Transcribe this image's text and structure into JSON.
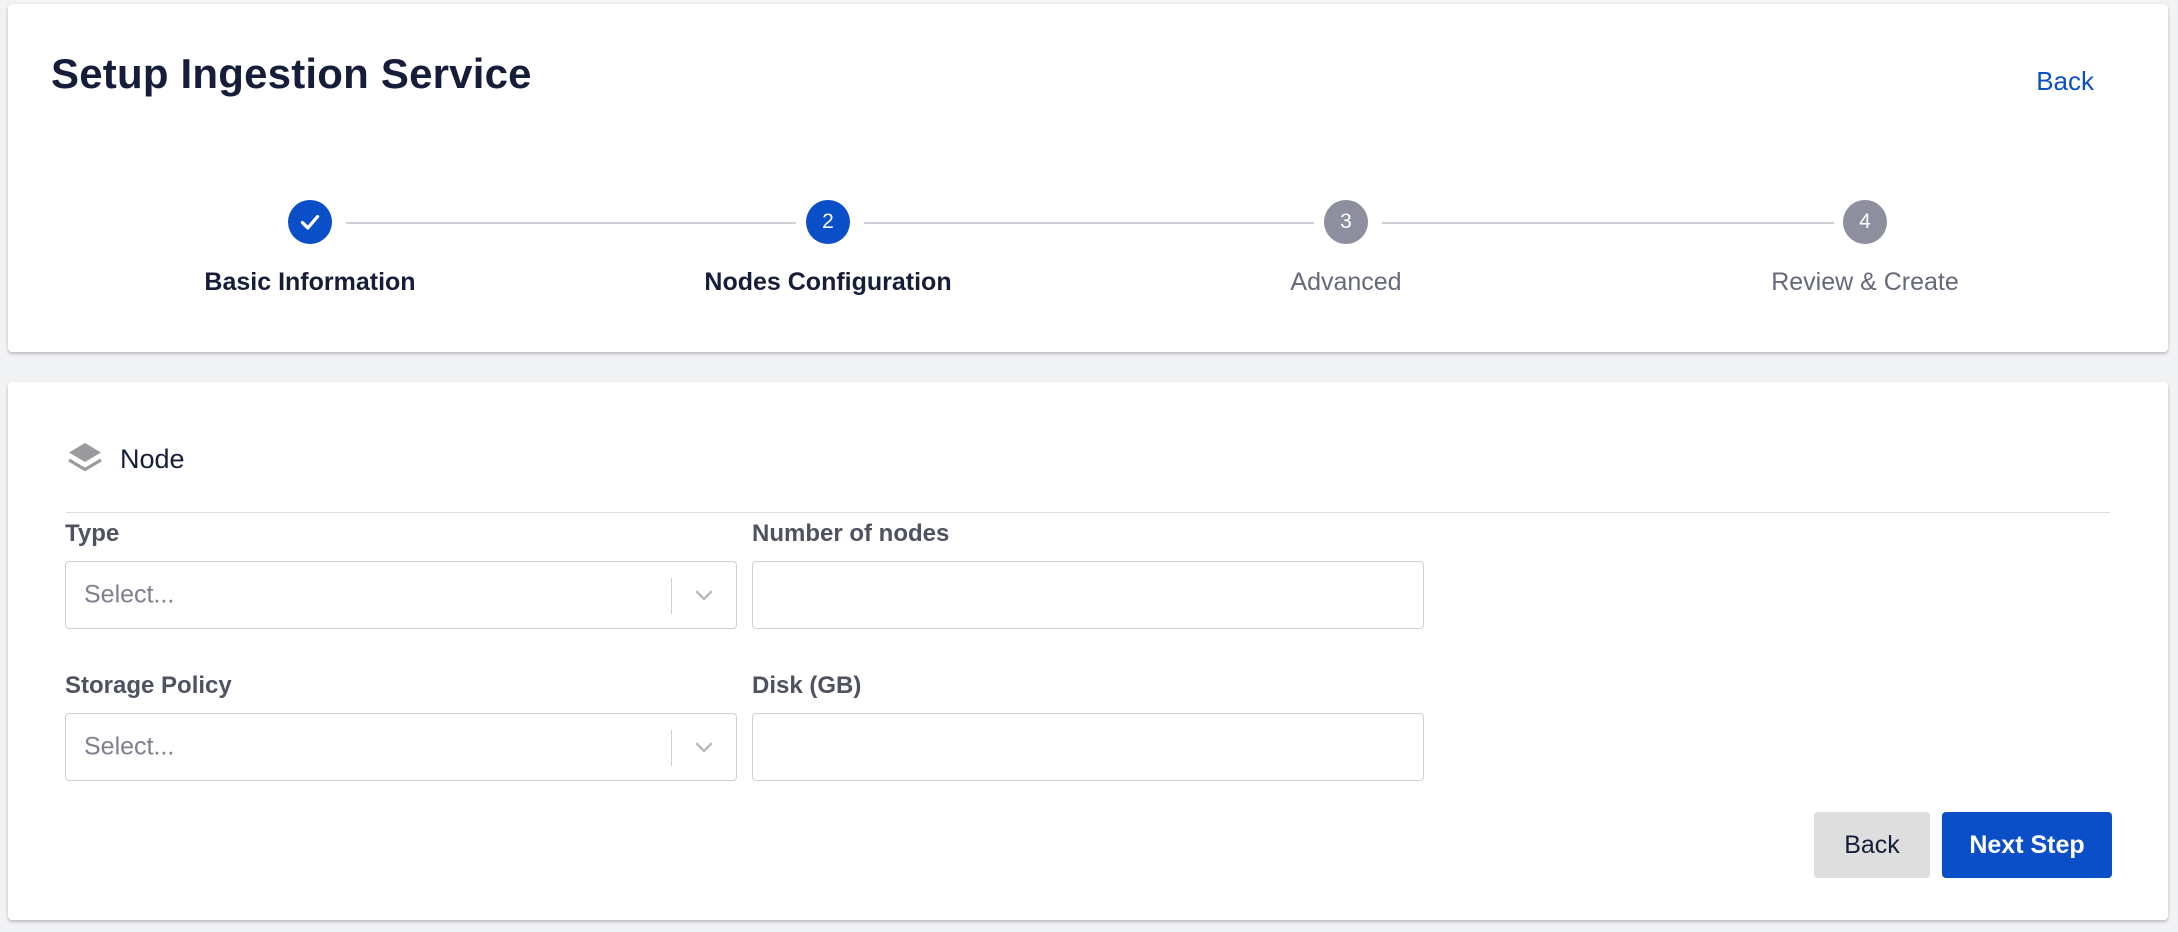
{
  "header": {
    "title": "Setup Ingestion Service",
    "back_label": "Back"
  },
  "stepper": {
    "steps": [
      {
        "number": "1",
        "label": "Basic Information",
        "state": "completed"
      },
      {
        "number": "2",
        "label": "Nodes Configuration",
        "state": "active"
      },
      {
        "number": "3",
        "label": "Advanced",
        "state": "pending"
      },
      {
        "number": "4",
        "label": "Review & Create",
        "state": "pending"
      }
    ]
  },
  "section": {
    "icon": "layers-icon",
    "title": "Node"
  },
  "form": {
    "type": {
      "label": "Type",
      "placeholder": "Select..."
    },
    "nodes": {
      "label": "Number of nodes",
      "value": ""
    },
    "storage": {
      "label": "Storage Policy",
      "placeholder": "Select..."
    },
    "disk": {
      "label": "Disk (GB)",
      "value": ""
    }
  },
  "actions": {
    "back_label": "Back",
    "next_label": "Next Step"
  },
  "colors": {
    "primary": "#0b4fc8",
    "pending_step": "#8d8f9e",
    "title_text": "#161d38"
  }
}
